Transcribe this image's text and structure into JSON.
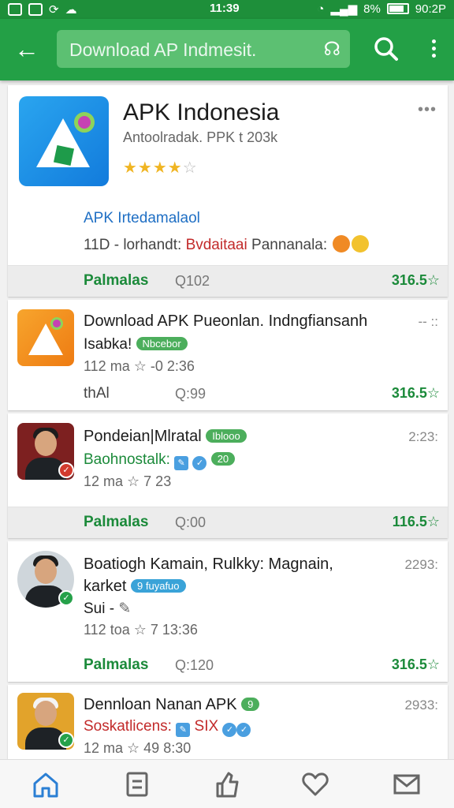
{
  "status_bar": {
    "time": "11:39",
    "battery": "8%",
    "right_text": "90:2P"
  },
  "app_bar": {
    "search_query": "Download AP Indmesit."
  },
  "main_app": {
    "title": "APK Indonesia",
    "subtitle": "Antoolradak. PPK t 203k",
    "rating_on": "★★★★",
    "rating_off": "☆",
    "developer": "APK Irtedamalaol",
    "meta_prefix": "11D - lorhandt:",
    "meta_red": "Bvdaitaai",
    "meta_suffix": "Pannanala:",
    "footer_left": "Palmalas",
    "footer_mid": "Q102",
    "footer_right": "316.5"
  },
  "rows": [
    {
      "title": "Download APK Pueonlan. Indngfiansanh",
      "line2": "Isabka!",
      "pill": "Nbcebor",
      "meta": "112 ma ☆ -0  2:36",
      "right": "-- ::",
      "footer_left": "thAl",
      "footer_mid": "Q:99",
      "footer_right": "316.5"
    },
    {
      "title": "Pondeian|Mlratal",
      "pill": "Iblooo",
      "line2": "Baohnostalk:",
      "badge_text": "20",
      "meta": "12 ma ☆ 7  23",
      "right": "2:23:",
      "footer_left": "Palmalas",
      "footer_mid": "Q:00",
      "footer_right": "116.5"
    },
    {
      "title": "Boatiogh Kamain, Rulkky: Magnain,",
      "title2": "karket",
      "pill": "9 fuyafuo",
      "line2": "Sui -",
      "meta": "112 toa ☆ 7  13:36",
      "right": "2293:",
      "footer_left": "Palmalas",
      "footer_mid": "Q:120",
      "footer_right": "316.5"
    },
    {
      "title": "Dennloan Nanan APK",
      "pill": "9",
      "line2": "Soskatlicens:",
      "line2_extra": "SIX",
      "meta": "12 ma ☆ 49  8:30",
      "right": "2933:"
    }
  ],
  "bottom_nav": [
    "home",
    "apps",
    "updates",
    "favorites",
    "messages"
  ]
}
